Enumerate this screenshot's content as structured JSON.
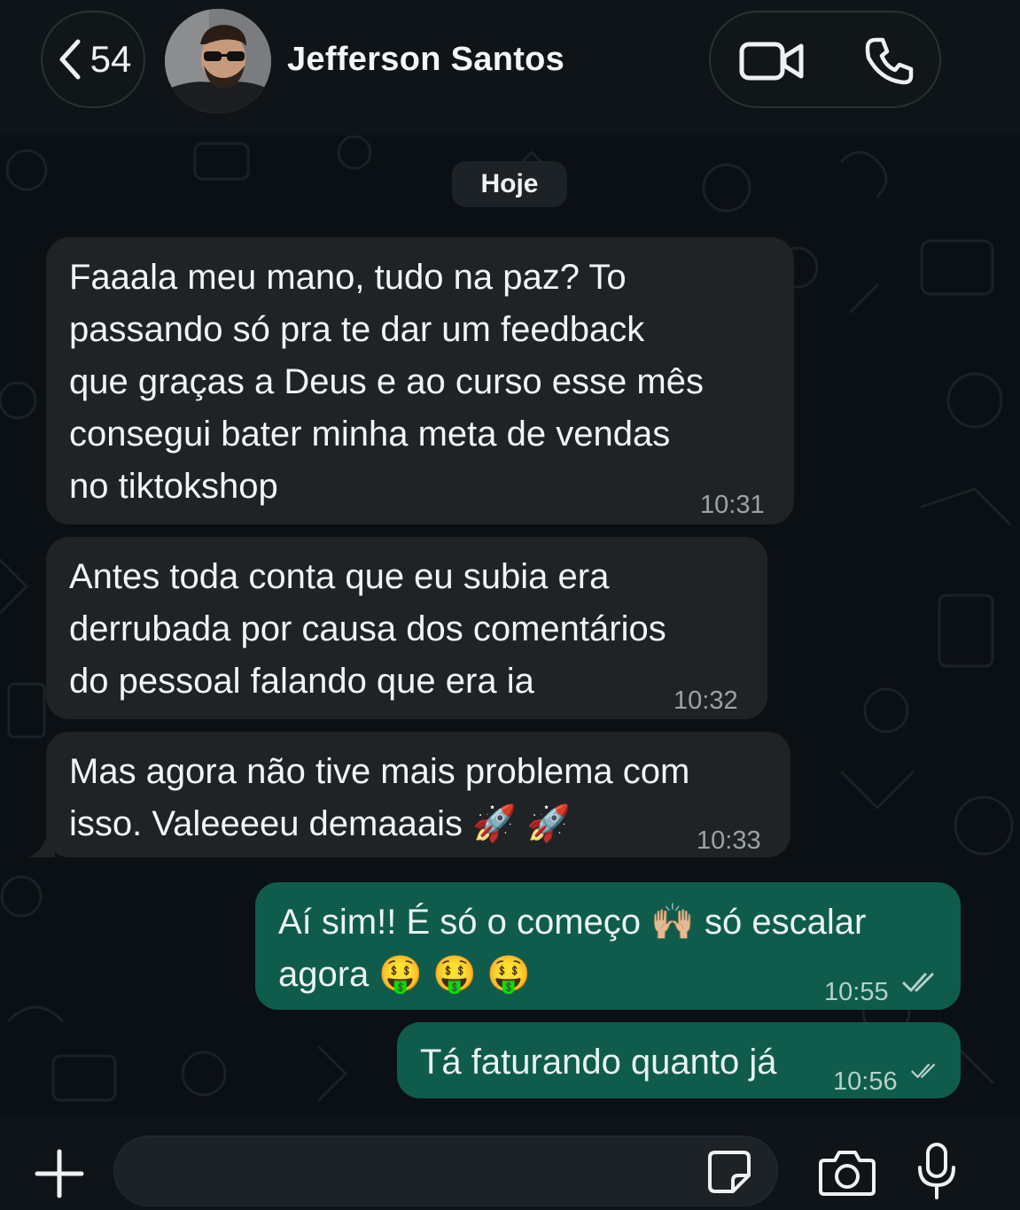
{
  "header": {
    "back_count": "54",
    "contact_name": "Jefferson Santos",
    "icons": [
      "chevron-left-icon",
      "avatar",
      "video-camera-icon",
      "phone-icon"
    ]
  },
  "chat": {
    "date_label": "Hoje",
    "messages": [
      {
        "direction": "incoming",
        "text": "Faaala meu mano, tudo na paz? To\npassando só pra te dar um feedback\nque graças a Deus e ao curso esse mês\nconsegui bater minha meta de vendas\nno tiktokshop",
        "time": "10:31"
      },
      {
        "direction": "incoming",
        "text": "Antes toda conta que eu subia era\nderrubada por causa dos comentários\ndo pessoal falando que era ia",
        "time": "10:32"
      },
      {
        "direction": "incoming",
        "text": "Mas agora não tive mais problema com\nisso. Valeeeeu demaaais 🚀 🚀",
        "time": "10:33"
      },
      {
        "direction": "outgoing",
        "text": "Aí sim!! É só o começo 🙌🏼 só escalar\nagora 🤑 🤑 🤑",
        "time": "10:55",
        "status": "read"
      },
      {
        "direction": "outgoing",
        "text": "Tá faturando quanto já",
        "time": "10:56",
        "status": "read"
      }
    ]
  },
  "composer": {
    "placeholder": "",
    "icons": [
      "plus-icon",
      "sticker-icon",
      "camera-icon",
      "microphone-icon"
    ]
  },
  "colors": {
    "background": "#0b1014",
    "incoming_bubble": "#1f2326",
    "outgoing_bubble": "#0f5c4c",
    "header": "#0f1418"
  }
}
